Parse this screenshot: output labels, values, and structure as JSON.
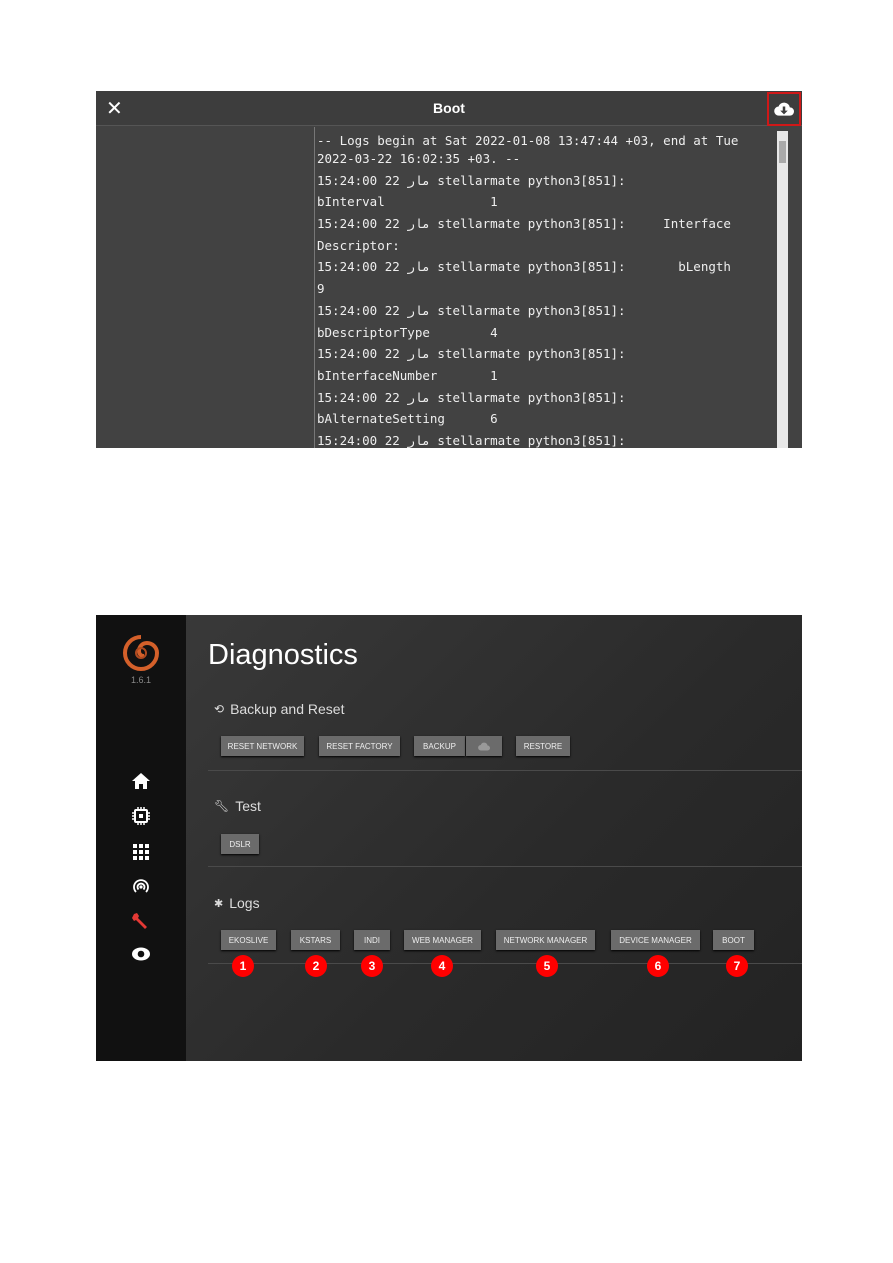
{
  "boot_dialog": {
    "title": "Boot",
    "close_icon": "close-icon",
    "download_icon": "cloud-download-icon",
    "highlight_color": "#d01818",
    "log_lines": [
      "-- Logs begin at Sat 2022-01-08 13:47:44 +03, end at Tue",
      "2022-03-22 16:02:35 +03. --",
      "15:24:00 22 مار stellarmate python3[851]:",
      "bInterval              1",
      "15:24:00 22 مار stellarmate python3[851]:     Interface",
      "Descriptor:",
      "15:24:00 22 مار stellarmate python3[851]:       bLength",
      "9",
      "15:24:00 22 مار stellarmate python3[851]:",
      "bDescriptorType        4",
      "15:24:00 22 مار stellarmate python3[851]:",
      "bInterfaceNumber       1",
      "15:24:00 22 مار stellarmate python3[851]:",
      "bAlternateSetting      6",
      "15:24:00 22 مار stellarmate python3[851]:"
    ]
  },
  "diagnostics": {
    "version": "1.6.1",
    "sidebar_icons": [
      "home-icon",
      "chip-icon",
      "apps-grid-icon",
      "wifi-tethering-icon",
      "wrench-icon",
      "eye-icon"
    ],
    "active_color": "#e53935",
    "title": "Diagnostics",
    "backup": {
      "heading": "Backup and Reset",
      "buttons": [
        "RESET NETWORK",
        "RESET FACTORY",
        "BACKUP",
        "RESTORE"
      ]
    },
    "test": {
      "heading": "Test",
      "buttons": [
        "DSLR"
      ]
    },
    "logs": {
      "heading": "Logs",
      "buttons": [
        "EKOSLIVE",
        "KSTARS",
        "INDI",
        "WEB MANAGER",
        "NETWORK MANAGER",
        "DEVICE MANAGER",
        "BOOT"
      ],
      "badges": [
        "1",
        "2",
        "3",
        "4",
        "5",
        "6",
        "7"
      ]
    }
  }
}
